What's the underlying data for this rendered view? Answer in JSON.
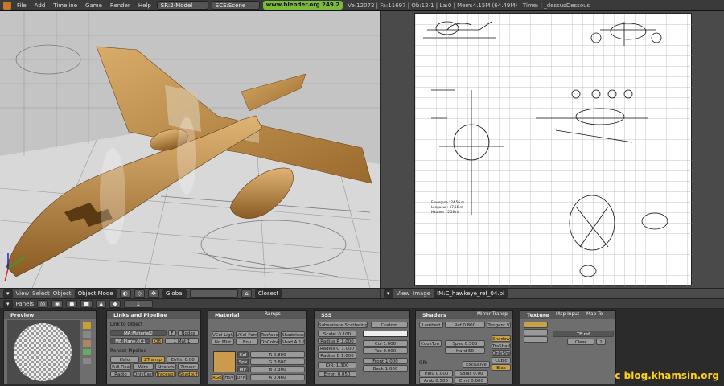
{
  "menu": {
    "file": "File",
    "add": "Add",
    "timeline": "Timeline",
    "game": "Game",
    "render": "Render",
    "help": "Help"
  },
  "topbar": {
    "screen": "SR:2-Model",
    "scene": "SCE:Scene",
    "url": "www.blender.org 249.2",
    "stats": "Ve:12072 | Fa:11697 | Ob:12-1 | La:0 | Mem:4.15M (64.49M) | Time: | _dessusDessous"
  },
  "header3d": {
    "view": "View",
    "select": "Select",
    "object": "Object",
    "mode": "Object Mode",
    "orientation": "Global"
  },
  "headerImage": {
    "closest": "Closest",
    "view": "View",
    "image": "Image",
    "imagename": "IM:C_hawkeye_ref_04.pi"
  },
  "panelsbar": {
    "label": "Panels",
    "frame": "1"
  },
  "preview": {
    "title": "Preview"
  },
  "links": {
    "title": "Links and Pipeline",
    "linkobj": "Link to Object",
    "material": "MA:Material2",
    "f": "F",
    "nodes": "Nodes",
    "me": "ME:Plane.001",
    "ob": "OB",
    "one": "1 Mat 1",
    "renderpipe": "Render Pipeline",
    "halo": "Halo",
    "ztransp": "ZTransp",
    "zoffs": "Zoffs: 0.00",
    "fullosa": "Full Osa",
    "wire": "Wire",
    "strands": "Strands",
    "zinvert": "Zinvert",
    "radio": "Radio",
    "onlycast": "OnlyCast",
    "traceable": "Traceable",
    "shadbuf": "Shadbuf"
  },
  "material": {
    "title": "Material",
    "ramps": "Ramps",
    "vcollight": "VCol Light",
    "vcolpaint": "VCol Paint",
    "texface": "TexFace",
    "shadeless": "Shadeless",
    "nomist": "No Mist",
    "env": "Env",
    "obcolor": "ObColor",
    "shada": "Shad A 1.00",
    "col": "Col",
    "spe": "Spe",
    "mir": "Mir",
    "r": "R 0.800",
    "g": "G 0.600",
    "b": "B 0.300",
    "a": "A 0.460",
    "rgb": "RGB",
    "hsv": "HSV",
    "dyn": "DYN"
  },
  "sss": {
    "title": "SSS",
    "sss": "Subsurface Scattering",
    "custom": "Custom",
    "scale": "Scale: 0.100",
    "rr": "Radius R 1.000",
    "rg": "Radius G 1.000",
    "rb": "Radius B 1.000",
    "ior": "IOR: 1.300",
    "error": "Error: 0.050",
    "colf": "Col 1.000",
    "texf": "Tex 0.000",
    "front": "Front 1.000",
    "back": "Back 1.000"
  },
  "shaders": {
    "title": "Shaders",
    "mirror": "Mirror Transp",
    "lambert": "Lambert",
    "ref": "Ref  0.800",
    "tangent": "Tangent V",
    "cooktorr": "CookTorr",
    "spec": "Spec 0.500",
    "hard": "Hard 50",
    "shadow": "Shadow",
    "trashado": "TraShado",
    "onlyshad": "OnlyShad",
    "cubic": "Cubic",
    "bias": "Bias",
    "gr": "GR:",
    "exclusive": "Exclusive",
    "tralu": "Tralu 0.000",
    "sbias": "SBias 0.00",
    "amb": "Amb 0.500",
    "emit": "Emit 0.000",
    "lbias": "LBias 0.00"
  },
  "texture": {
    "title": "Texture",
    "mapinput": "Map Input",
    "mapto": "Map To",
    "te": "TE:ref",
    "clear": "Clear",
    "num": "2"
  },
  "watermark": "c blog.khamsin.org"
}
